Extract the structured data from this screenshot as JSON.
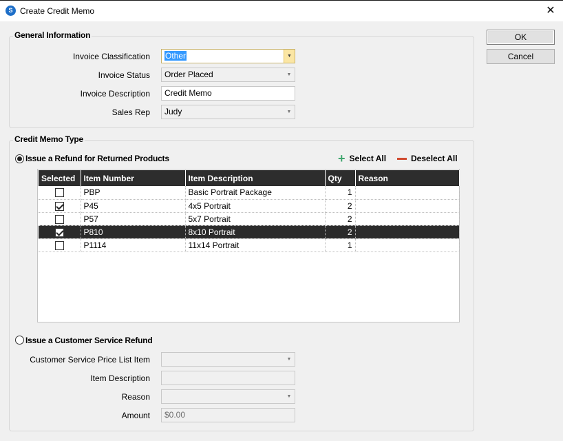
{
  "window": {
    "title": "Create Credit Memo",
    "app_icon_glyph": "S",
    "close_glyph": "✕"
  },
  "buttons": {
    "ok": "OK",
    "cancel": "Cancel"
  },
  "general": {
    "title": "General Information",
    "invoice_classification": {
      "label": "Invoice Classification",
      "value": "Other"
    },
    "invoice_status": {
      "label": "Invoice Status",
      "value": "Order Placed"
    },
    "invoice_description": {
      "label": "Invoice Description",
      "value": "Credit Memo"
    },
    "sales_rep": {
      "label": "Sales Rep",
      "value": "Judy"
    }
  },
  "credit_memo_type": {
    "title": "Credit Memo Type",
    "refund_option": {
      "label": "Issue a Refund for Returned Products",
      "checked": true
    },
    "select_all": "Select All",
    "deselect_all": "Deselect All",
    "table": {
      "columns": [
        "Selected",
        "Item Number",
        "Item Description",
        "Qty",
        "Reason"
      ],
      "rows": [
        {
          "selected": false,
          "item_number": "PBP",
          "description": "Basic Portrait Package",
          "qty": "1",
          "reason": ""
        },
        {
          "selected": true,
          "item_number": "P45",
          "description": "4x5 Portrait",
          "qty": "2",
          "reason": ""
        },
        {
          "selected": false,
          "item_number": "P57",
          "description": "5x7 Portrait",
          "qty": "2",
          "reason": ""
        },
        {
          "selected": true,
          "item_number": "P810",
          "description": "8x10 Portrait",
          "qty": "2",
          "reason": "",
          "highlighted": true
        },
        {
          "selected": false,
          "item_number": "P1114",
          "description": "11x14 Portrait",
          "qty": "1",
          "reason": ""
        }
      ]
    },
    "service_option": {
      "label": "Issue a Customer Service Refund",
      "checked": false
    },
    "service_fields": {
      "price_list_item": {
        "label": "Customer Service Price List Item",
        "value": ""
      },
      "item_description": {
        "label": "Item Description",
        "value": ""
      },
      "reason": {
        "label": "Reason",
        "value": ""
      },
      "amount": {
        "label": "Amount",
        "value": "$0.00"
      }
    }
  },
  "colors": {
    "header_bg": "#2d2d2d",
    "highlight_row": "#2b2b2b",
    "selection": "#3399ff",
    "add_green": "#3fa66e",
    "remove_red": "#d04a2f"
  }
}
